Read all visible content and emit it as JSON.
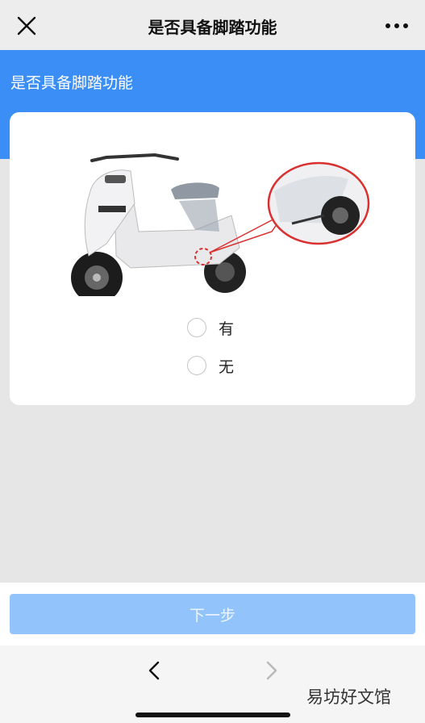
{
  "topbar": {
    "title": "是否具备脚踏功能",
    "close_icon": "close-icon",
    "more_icon": "more-icon"
  },
  "question": {
    "heading": "是否具备脚踏功能",
    "options": [
      {
        "label": "有",
        "selected": false
      },
      {
        "label": "无",
        "selected": false
      }
    ]
  },
  "actions": {
    "next_label": "下一步"
  },
  "navbar": {
    "back_icon": "chevron-left-icon",
    "forward_icon": "chevron-right-icon"
  },
  "watermark": "易坊好文馆",
  "colors": {
    "accent_blue": "#3a8ef6",
    "button_disabled": "#92c4fb",
    "background": "#e6e6e6"
  }
}
